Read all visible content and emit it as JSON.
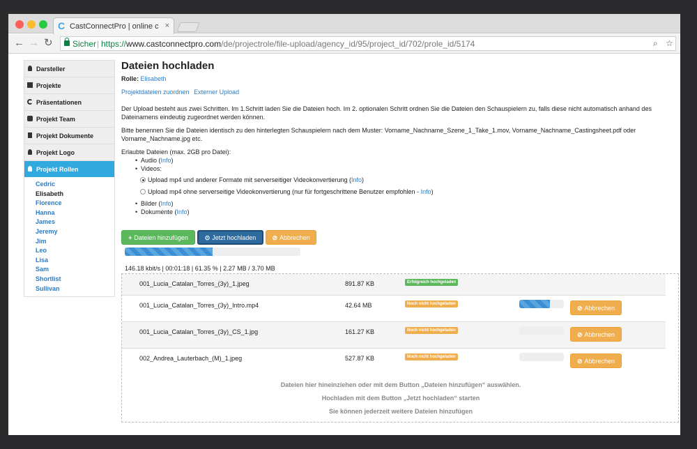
{
  "browser": {
    "tab_title": "CastConnectPro | online castin",
    "tab_close": "×",
    "secure_label": "Sicher",
    "url_scheme": "https://",
    "url_host": "www.castconnectpro.com",
    "url_path": "/de/projectrole/file-upload/agency_id/95/project_id/702/prole_id/5174"
  },
  "sidebar": {
    "items": [
      {
        "label": "Darsteller",
        "icon": "user-icon"
      },
      {
        "label": "Projekte",
        "icon": "grid-icon"
      },
      {
        "label": "Präsentationen",
        "icon": "share-icon"
      },
      {
        "label": "Projekt Team",
        "icon": "team-icon"
      },
      {
        "label": "Projekt Dokumente",
        "icon": "document-icon"
      },
      {
        "label": "Projekt Logo",
        "icon": "user-icon"
      },
      {
        "label": "Projekt Rollen",
        "icon": "user-icon",
        "active": true
      }
    ],
    "roles": [
      "Cedric",
      "Elisabeth",
      "Florence",
      "Hanna",
      "James",
      "Jeremy",
      "Jim",
      "Leo",
      "Lisa",
      "Sam",
      "Shortlist",
      "Sullivan"
    ],
    "current_role": "Elisabeth"
  },
  "main": {
    "title": "Dateien hochladen",
    "role_label": "Rolle:",
    "role_value": "Elisabeth",
    "link_assign": "Projektdateien zuordnen",
    "link_external": "Externer Upload",
    "para1_line1": "Der Upload besteht aus zwei Schritten. Im 1.Schritt laden Sie die Dateien hoch. Im 2. optionalen Schritt ordnen Sie die Dateien den Schauspielern zu, falls diese nicht automatisch anhand des",
    "para1_line2": "Dateinamens eindeutig zugeordnet werden können.",
    "para2_line1": "Bitte benennen Sie die Dateien identisch zu den hinterlegten Schauspielern nach dem Muster: Vorname_Nachname_Szene_1_Take_1.mov, Vorname_Nachname_Castingsheet.pdf oder",
    "para2_line2": "Vorname_Nachname.jpg etc.",
    "allowed_label": "Erlaubte Dateien (max. 2GB pro Datei):",
    "audio": "Audio",
    "videos": "Videos:",
    "bilder": "Bilder",
    "dokumente": "Dokumente",
    "info": "Info",
    "radio1": "Upload mp4 und anderer Formate mit serverseitiger Videokonvertierung",
    "radio2": "Upload mp4 ohne serverseitige Videokonvertierung (nur für fortgeschrittene Benutzer empfohlen -",
    "btn_add": "Dateien hinzufügen",
    "btn_upload": "Jetzt hochladen",
    "btn_cancel": "Abbrechen",
    "overall_progress": 0.5,
    "stats": "146.18 kbit/s | 00:01:18 | 61.35 % | 2.27 MB / 3.70 MB"
  },
  "files": [
    {
      "name": "001_Lucia_Catalan_Torres_(3y)_1.jpeg",
      "size": "891.87 KB",
      "status": "Erfolgreich hochgeladen",
      "state": "ok"
    },
    {
      "name": "001_Lucia_Catalan_Torres_(3y)_Intro.mp4",
      "size": "42.64 MB",
      "status": "Noch nicht hochgeladen",
      "state": "wait",
      "progress": 0.68
    },
    {
      "name": "001_Lucia_Catalan_Torres_(3y)_CS_1.jpg",
      "size": "161.27 KB",
      "status": "Noch nicht hochgeladen",
      "state": "wait",
      "progress": 0
    },
    {
      "name": "002_Andrea_Lauterbach_(M)_1.jpeg",
      "size": "527.87 KB",
      "status": "Noch nicht hochgeladen",
      "state": "wait",
      "progress": 0
    }
  ],
  "dropzone": {
    "line1": "Dateien hier hineinziehen oder mit dem Button „Dateien hinzufügen“ auswählen.",
    "line2": "Hochladen mit dem Button „Jetzt hochladen“ starten",
    "line3": "Sie können jederzeit weitere Dateien hinzufügen"
  },
  "colors": {
    "accent": "#31a9df",
    "success": "#5cb85c",
    "warning": "#f0ad4e",
    "primary": "#2f6a9e",
    "link": "#2a7cc7"
  }
}
